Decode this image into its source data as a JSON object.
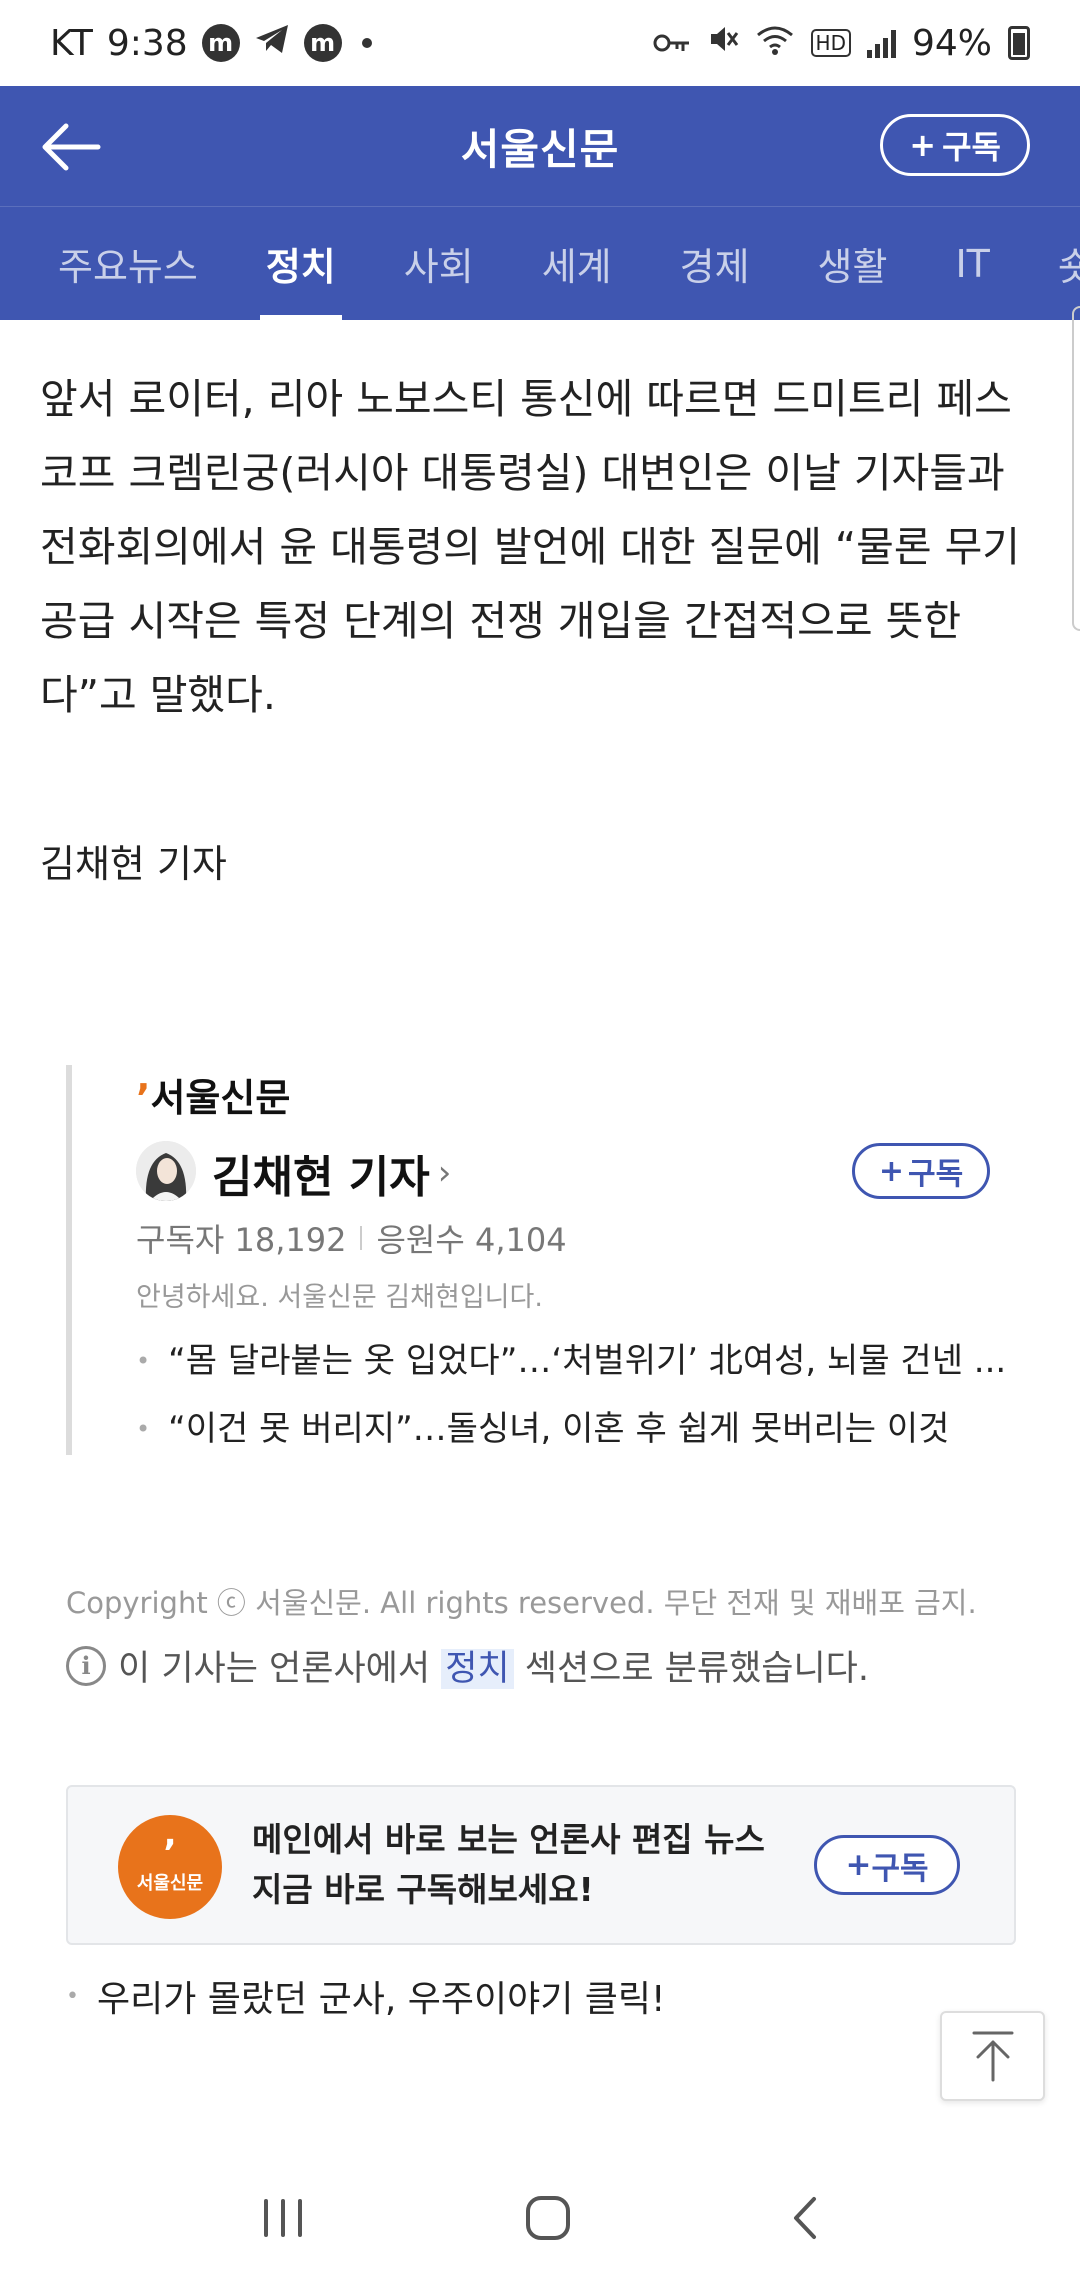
{
  "status_bar": {
    "carrier": "KT",
    "time": "9:38",
    "app_badges": [
      "m",
      "m"
    ],
    "network": "HD",
    "battery": "94%"
  },
  "header": {
    "title": "서울신문",
    "subscribe": "구독"
  },
  "tabs": [
    "주요뉴스",
    "정치",
    "사회",
    "세계",
    "경제",
    "생활",
    "IT",
    "숏폼"
  ],
  "article": {
    "body": "앞서 로이터, 리아 노보스티 통신에 따르면 드미트리 페스코프 크렘린궁(러시아 대통령실) 대변인은 이날 기자들과 전화회의에서 윤 대통령의 발언에 대한 질문에 “물론 무기 공급 시작은 특정 단계의 전쟁 개입을 간접적으로 뜻한다”고 말했다.",
    "byline": "김채현 기자"
  },
  "reporter_card": {
    "logo": "서울신문",
    "name": "김채현 기자",
    "subscribe": "구독",
    "subscribers_label": "구독자 18,192",
    "supporters_label": "응원수 4,104",
    "greeting": "안녕하세요. 서울신문 김채현입니다.",
    "articles": [
      "“몸 달라붙는 옷 입었다”…‘처벌위기’ 北여성, 뇌물 건넨 ...",
      "“이건 못 버리지”…돌싱녀, 이혼 후 쉽게 못버리는 이것"
    ]
  },
  "footer": {
    "copyright": "Copyright ⓒ 서울신문. All rights reserved. 무단 전재 및 재배포 금지.",
    "classify_prefix": "이 기사는 언론사에서",
    "classify_section": "정치",
    "classify_suffix": "섹션으로 분류했습니다."
  },
  "promo": {
    "logo_text": "서울신문",
    "line1": "메인에서 바로 보는 언론사 편집 뉴스",
    "line2": "지금 바로 구독해보세요!",
    "subscribe": "구독"
  },
  "more_link": "우리가 몰랐던 군사, 우주이야기 클릭!",
  "colors": {
    "brand_blue": "#3f56b1",
    "accent_orange": "#e8731b"
  }
}
